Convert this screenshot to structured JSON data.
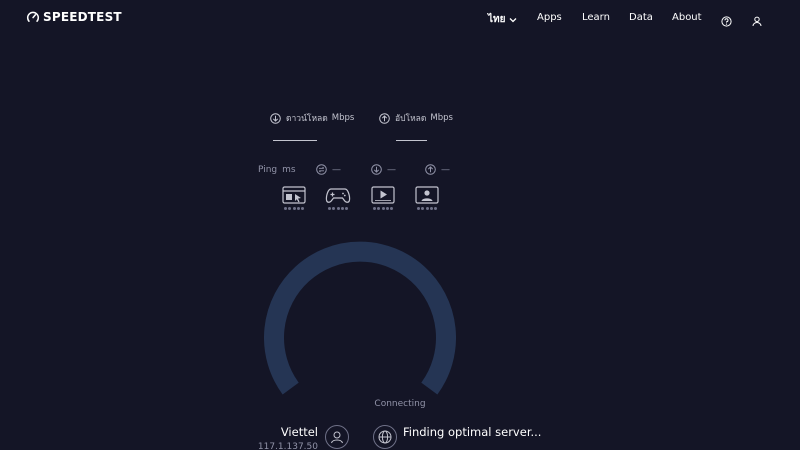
{
  "header": {
    "brand": "SPEEDTEST",
    "language": "ไทย",
    "nav": [
      "Apps",
      "Learn",
      "Data",
      "About"
    ]
  },
  "metrics": {
    "download": {
      "label": "ดาวน์โหลด",
      "unit": "Mbps",
      "value": ""
    },
    "upload": {
      "label": "อัปโหลด",
      "unit": "Mbps",
      "value": ""
    },
    "ping": {
      "label": "Ping",
      "unit": "ms"
    },
    "idle_latency": "—",
    "download_latency": "—",
    "upload_latency": "—"
  },
  "activities": [
    {
      "icon": "web-browsing-icon"
    },
    {
      "icon": "gaming-icon"
    },
    {
      "icon": "video-streaming-icon"
    },
    {
      "icon": "video-chat-icon"
    }
  ],
  "gauge": {
    "status": "Connecting"
  },
  "connection": {
    "isp": "Viettel",
    "ip": "117.1.137.50",
    "server_status": "Finding optimal server..."
  },
  "colors": {
    "background": "#141526",
    "gauge_track": "#253554",
    "text_muted": "#9193a8"
  }
}
